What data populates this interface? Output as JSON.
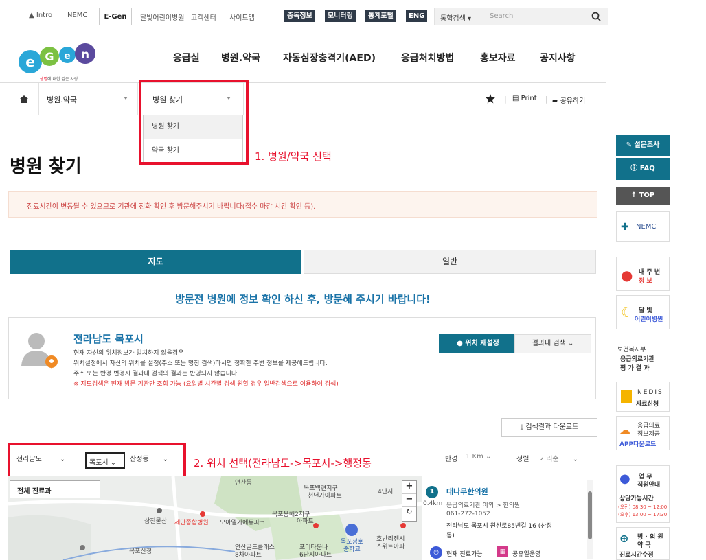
{
  "topbar": {
    "intro": "Intro",
    "nemc": "NEMC",
    "egen": "E-Gen",
    "moon": "달빛어린이병원",
    "customer": "고객센터",
    "sitemap": "사이트맵",
    "severe": "중독정보",
    "monitor": "모니터링",
    "stats": "통계포털",
    "eng": "ENG",
    "search_scope": "통합검색",
    "search_placeholder": "Search"
  },
  "logo": {
    "tagline_red": "생명",
    "tagline_rest": "에 대한 깊은 사랑"
  },
  "gnb": [
    "응급실",
    "병원.약국",
    "자동심장충격기(AED)",
    "응급처치방법",
    "홍보자료",
    "공지사항"
  ],
  "breadcrumb": {
    "level1": "병원.약국",
    "level2": "병원 찾기",
    "print": "Print",
    "share": "공유하기"
  },
  "dropdown": [
    "병원 찾기",
    "약국 찾기"
  ],
  "annotations": {
    "step1": "1. 병원/약국 선택",
    "step2": "2. 위치 선택(전라남도->목포시->행정동"
  },
  "page_title": "병원 찾기",
  "notice": "진료시간이 변동될 수 있으므로 기관에 전화 확인 후 방문해주시기 바랍니다(접수 마감 시간 확인 등).",
  "tabs": {
    "map": "지도",
    "general": "일반"
  },
  "guide": "방문전 병원에 정보 확인 하신 후, 방문해 주시기 바랍니다!",
  "location": {
    "place": "전라남도 목포시",
    "lines": [
      "현재 자신의 위치정보가 일치하지 않을경우",
      "위치설정에서 자신의 위치를 설정(주소 또는 명칭 검색)하시면 정확한 주변 정보를 제공해드립니다.",
      "주소 또는 반경 변경시 결과내 검색의 결과는 반영되지 않습니다."
    ],
    "warning": "※ 지도검색은 현재 방문 기관만 조회 가능 (요일별 시간별 검색 원할 경우 일반검색으로 이용하여 검색)",
    "btn_reset": "위치 재설정",
    "btn_inside": "결과내 검색"
  },
  "download": "검색결과 다운로드",
  "filters": {
    "province": "전라남도",
    "city": "목포시",
    "dong": "산정동",
    "radius_label": "반경",
    "radius": "1 Km",
    "sort_label": "정렬",
    "sort": "거리순"
  },
  "map": {
    "category": "전체 진료과",
    "labels": [
      "연산동",
      "목포백련지구",
      "천년가아파트",
      "4단지",
      "삼진물산",
      "세안종합병원",
      "모아엘가에듀파크",
      "목포용해2지구",
      "아파트",
      "목포청호",
      "중학교",
      "호반리젠시",
      "스위트아파",
      "목포산정",
      "연산골드클래스",
      "포미타운나",
      "6단지아파트",
      "8차아파트"
    ]
  },
  "result": {
    "num": "1",
    "name": "대나무한의원",
    "dist": "0.4km",
    "type": "응급의료기관 이외 > 한의원",
    "phone": "061-272-1052",
    "addr1": "전라남도 목포시 원산로85번길 16 (산정",
    "addr2": "동)",
    "status": "현재 진료가능",
    "holiday": "공휴일운영"
  },
  "quick": {
    "survey": "설문조사",
    "faq": "FAQ",
    "top": "TOP",
    "nemc": "NEMC",
    "near_a": "내 주 변",
    "near_b": "정 보",
    "moon_a": "달 빛",
    "moon_b": "어린이병원",
    "mohw": "보건복지부",
    "eval_a": "응급의료기관",
    "eval_b": "평 가 결 과",
    "nedis_a": "NEDIS",
    "nedis_b": "자료신청",
    "app_a": "응급의료",
    "app_b": "정보제공",
    "app_c": "APP다운로드",
    "staff_a": "업 무",
    "staff_b": "직원안내",
    "consult": "상담가능시간",
    "am": "(오전) 08:30 ~ 12:00",
    "pm": "(오후) 13:00 ~ 17:30",
    "hosp_a": "병 · 의 원",
    "hosp_b": "약 국",
    "hosp_c": "진료시간수정"
  }
}
